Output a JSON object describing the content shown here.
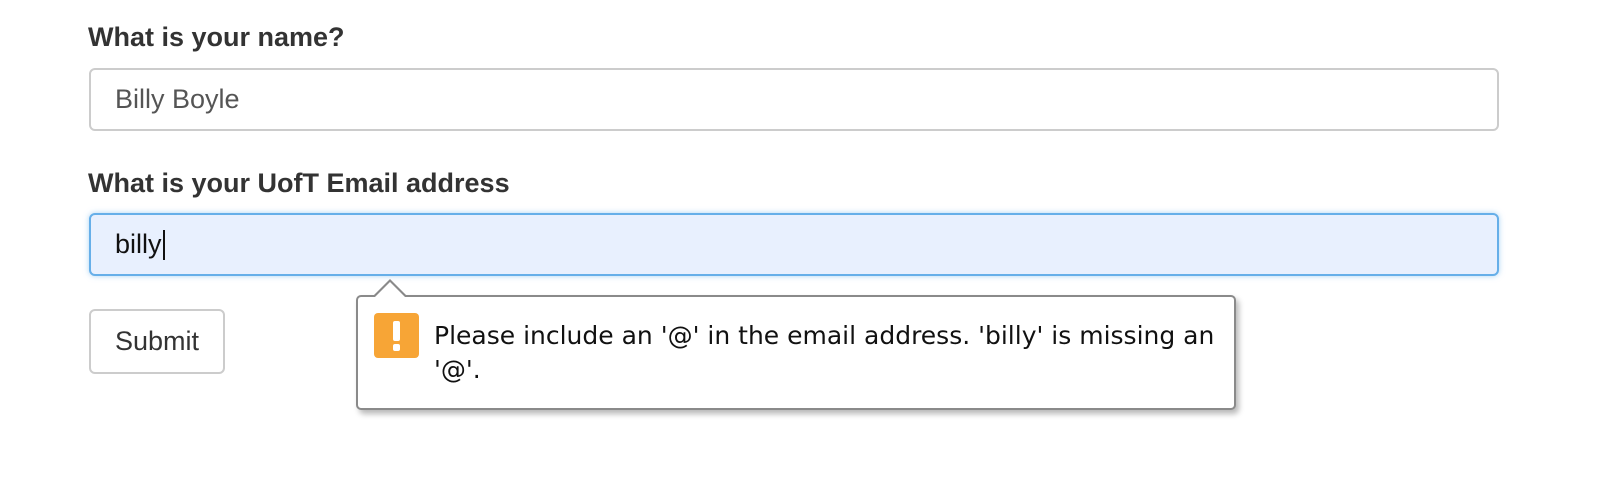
{
  "form": {
    "name_label": "What is your name?",
    "name_value": "Billy Boyle",
    "email_label": "What is your UofT Email address",
    "email_value": "billy",
    "submit_label": "Submit"
  },
  "validation_tooltip": {
    "icon": "warning-icon",
    "message": "Please include an '@' in the email address. 'billy' is missing an '@'."
  },
  "colors": {
    "focus_border": "#66afe9",
    "focused_input_bg": "#e8f0fe",
    "warning_icon": "#f7a536"
  }
}
